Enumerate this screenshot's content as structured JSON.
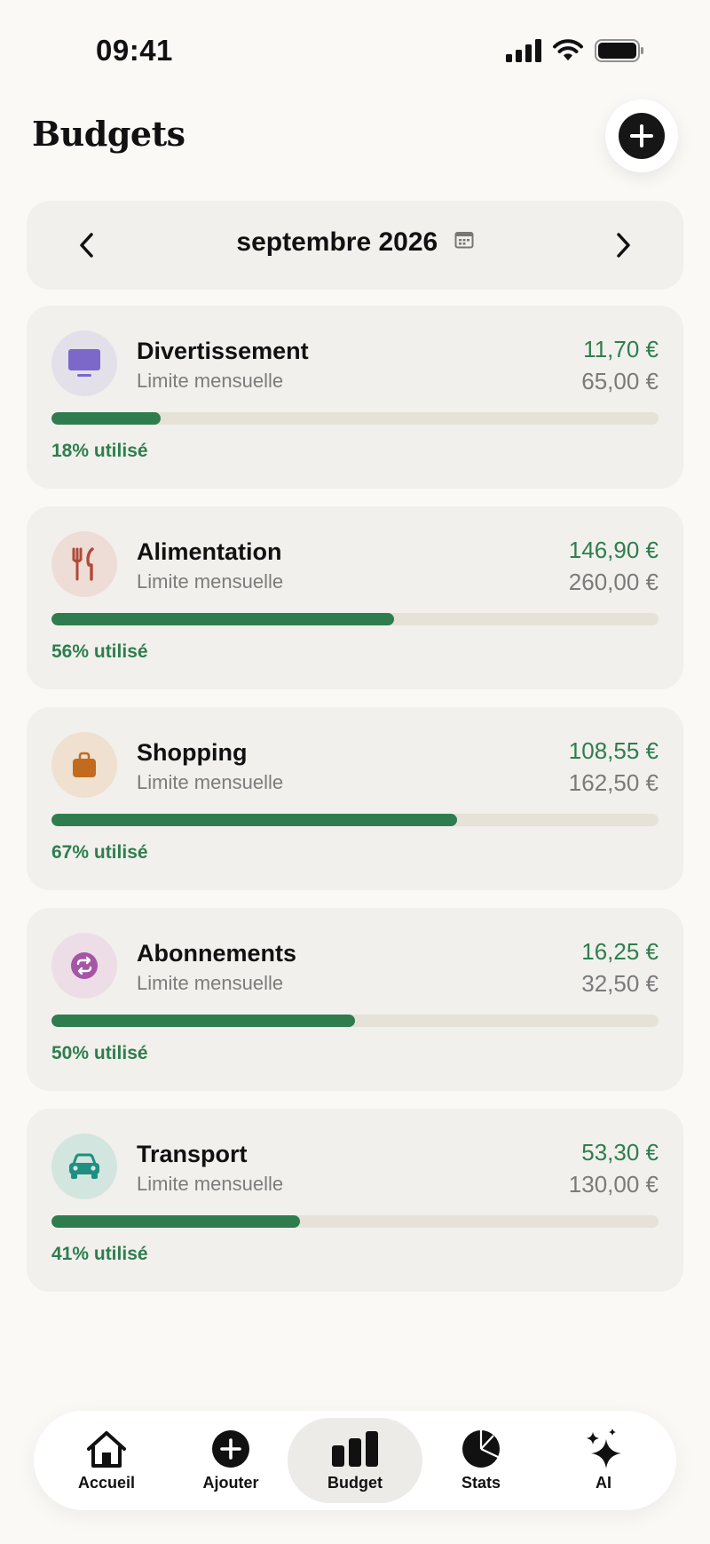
{
  "status": {
    "time": "09:41"
  },
  "header": {
    "title": "Budgets"
  },
  "month_nav": {
    "label": "septembre 2026"
  },
  "budgets": [
    {
      "name": "Divertissement",
      "subtitle": "Limite mensuelle",
      "spent": "11,70 €",
      "limit": "65,00 €",
      "used_label": "18% utilisé",
      "used_fraction": 0.18,
      "icon": "tv-icon",
      "icon_color": "#7c68c8",
      "icon_bg": "#e4e0ea"
    },
    {
      "name": "Alimentation",
      "subtitle": "Limite mensuelle",
      "spent": "146,90 €",
      "limit": "260,00 €",
      "used_label": "56% utilisé",
      "used_fraction": 0.565,
      "icon": "fork-knife-icon",
      "icon_color": "#b04a38",
      "icon_bg": "#eedcd6"
    },
    {
      "name": "Shopping",
      "subtitle": "Limite mensuelle",
      "spent": "108,55 €",
      "limit": "162,50 €",
      "used_label": "67% utilisé",
      "used_fraction": 0.668,
      "icon": "shopping-bag-icon",
      "icon_color": "#c26a1e",
      "icon_bg": "#efe0cf"
    },
    {
      "name": "Abonnements",
      "subtitle": "Limite mensuelle",
      "spent": "16,25 €",
      "limit": "32,50 €",
      "used_label": "50% utilisé",
      "used_fraction": 0.5,
      "icon": "repeat-icon",
      "icon_color": "#a655a6",
      "icon_bg": "#ecdde6"
    },
    {
      "name": "Transport",
      "subtitle": "Limite mensuelle",
      "spent": "53,30 €",
      "limit": "130,00 €",
      "used_label": "41% utilisé",
      "used_fraction": 0.41,
      "icon": "car-icon",
      "icon_color": "#1e8f80",
      "icon_bg": "#d2e5df"
    }
  ],
  "tabbar": {
    "items": [
      {
        "label": "Accueil",
        "icon": "home-icon"
      },
      {
        "label": "Ajouter",
        "icon": "plus-circle-icon"
      },
      {
        "label": "Budget",
        "icon": "bar-chart-icon",
        "active": true
      },
      {
        "label": "Stats",
        "icon": "pie-chart-icon"
      },
      {
        "label": "AI",
        "icon": "sparkles-icon"
      }
    ]
  },
  "colors": {
    "accent_green": "#2f7d4f",
    "background": "#faf9f6",
    "card": "#f1f0ec"
  }
}
